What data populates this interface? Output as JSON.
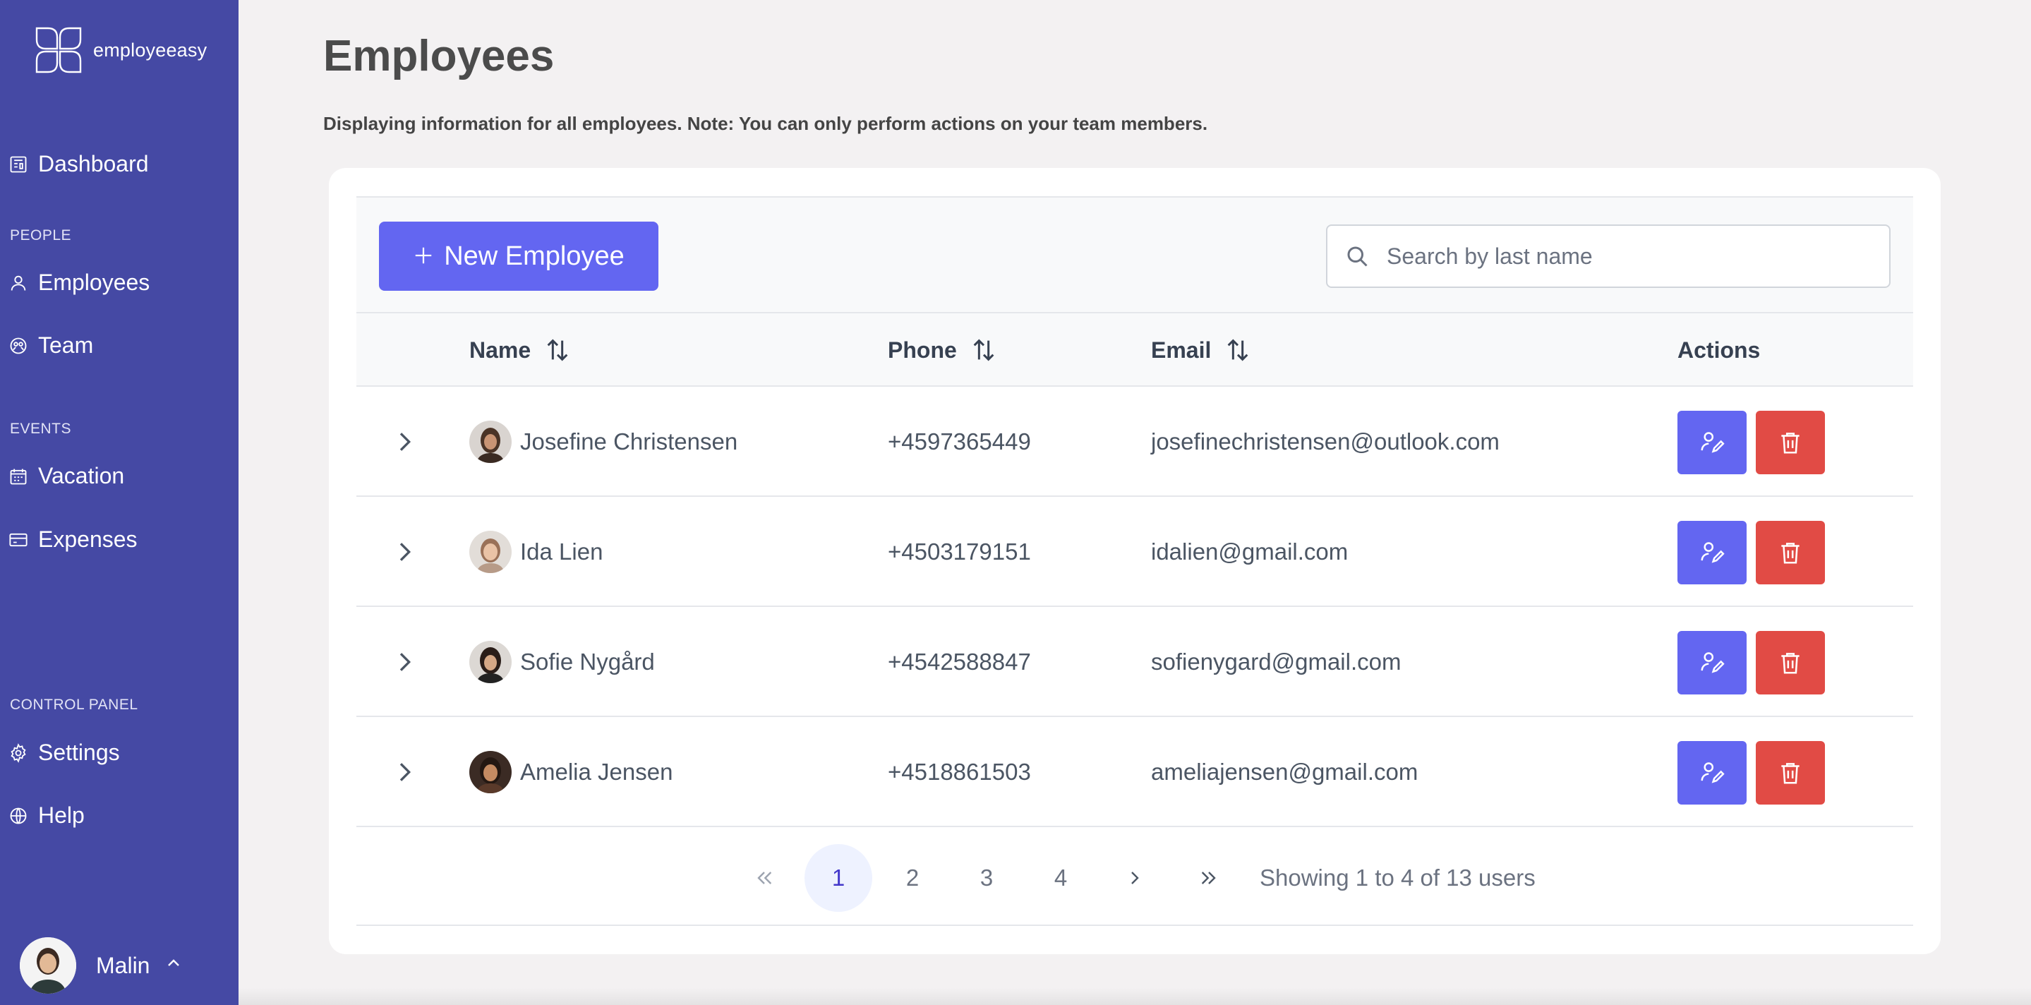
{
  "app": {
    "name": "employeeasy"
  },
  "sidebar": {
    "items": [
      {
        "label": "Dashboard",
        "icon": "dashboard-icon"
      },
      {
        "label": "Employees",
        "icon": "user-icon"
      },
      {
        "label": "Team",
        "icon": "team-icon"
      },
      {
        "label": "Vacation",
        "icon": "calendar-icon"
      },
      {
        "label": "Expenses",
        "icon": "credit-card-icon"
      },
      {
        "label": "Settings",
        "icon": "gear-icon"
      },
      {
        "label": "Help",
        "icon": "globe-icon"
      }
    ],
    "sections": [
      "PEOPLE",
      "EVENTS",
      "CONTROL PANEL"
    ],
    "user": {
      "name": "Malin"
    }
  },
  "page": {
    "title": "Employees",
    "note": "Displaying information for all employees. Note: You can only perform actions on your team members."
  },
  "toolbar": {
    "new_button_label": "New Employee",
    "search_placeholder": "Search by last name"
  },
  "table": {
    "columns": [
      "Name",
      "Phone",
      "Email",
      "Actions"
    ],
    "rows": [
      {
        "name": "Josefine Christensen",
        "phone": "+4597365449",
        "email": "josefinechristensen@outlook.com"
      },
      {
        "name": "Ida Lien",
        "phone": "+4503179151",
        "email": "idalien@gmail.com"
      },
      {
        "name": "Sofie Nygård",
        "phone": "+4542588847",
        "email": "sofienygard@gmail.com"
      },
      {
        "name": "Amelia Jensen",
        "phone": "+4518861503",
        "email": "ameliajensen@gmail.com"
      }
    ]
  },
  "pagination": {
    "pages": [
      "1",
      "2",
      "3",
      "4"
    ],
    "current": "1",
    "info": "Showing 1 to 4 of 13 users"
  },
  "colors": {
    "sidebar": "#4549a4",
    "primary": "#6366f1",
    "danger": "#e14b45"
  }
}
